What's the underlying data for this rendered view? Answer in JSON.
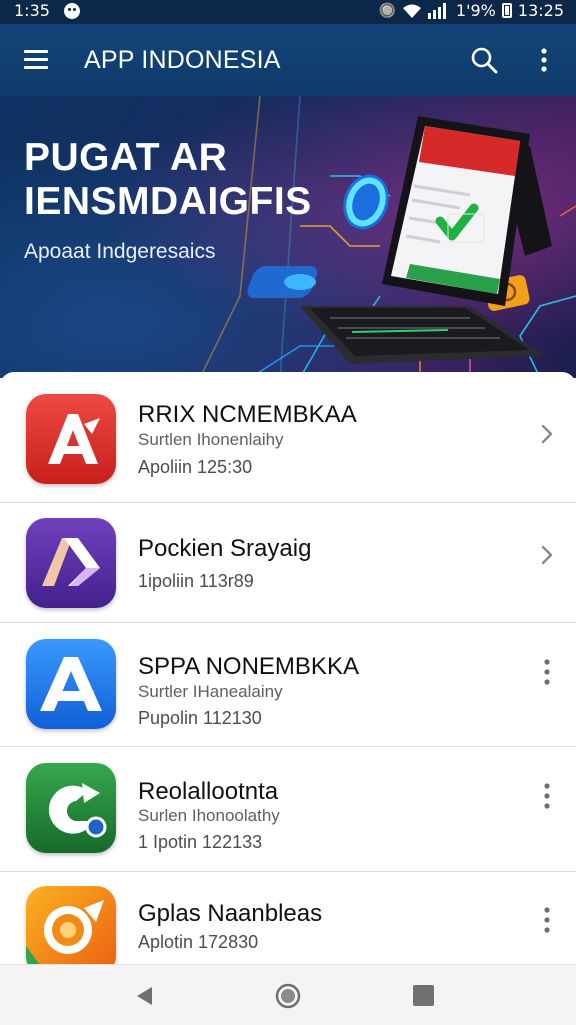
{
  "status_bar": {
    "time_left": "1:35",
    "battery_percent": "1'9%",
    "time_right": "13:25",
    "icons": [
      "notification-icon",
      "vibrate-icon",
      "wifi-icon",
      "signal-icon",
      "battery-icon"
    ]
  },
  "app_bar": {
    "title": "APP INDONESIA",
    "icons": [
      "menu-icon",
      "search-icon",
      "more-vert-icon"
    ]
  },
  "hero": {
    "title_line1": "PUGAT AR",
    "title_line2": "IENSMDAIGFIS",
    "subtitle": "Apoaat Indgeresaics"
  },
  "apps": [
    {
      "name": "RRIX NCMEMBKAA",
      "subtitle": "Surtlen Ihonenlaihy",
      "meta": "Apoliin 125:30",
      "trailing": "chevron-right-icon",
      "icon_colors": [
        "#e8443f",
        "#c7221f"
      ]
    },
    {
      "name": "Pockien Srayaig",
      "subtitle": "",
      "meta": "1ipoliin 113r89",
      "trailing": "chevron-right-icon",
      "icon_colors": [
        "#6a3cb5",
        "#4a2696"
      ]
    },
    {
      "name": "SPPA NONEMBKKA",
      "subtitle": "Surtler IHanealainy",
      "meta": "Pupolin 112130",
      "trailing": "more-vert-icon",
      "icon_colors": [
        "#2f8cf5",
        "#1463d8"
      ]
    },
    {
      "name": "Reolallootnta",
      "subtitle": "Surlen Ihonoolathy",
      "meta": "1 Ipotin 122133",
      "trailing": "more-vert-icon",
      "icon_colors": [
        "#2e9a45",
        "#1a6e2e"
      ]
    },
    {
      "name": "Gplas Naanbleas",
      "subtitle": "",
      "meta": "Aplotin 172830",
      "trailing": "more-vert-icon",
      "icon_colors": [
        "#f7a21a",
        "#ee6a12"
      ]
    }
  ],
  "nav_bar": {
    "icons": [
      "back-icon",
      "home-icon",
      "recents-icon"
    ]
  }
}
